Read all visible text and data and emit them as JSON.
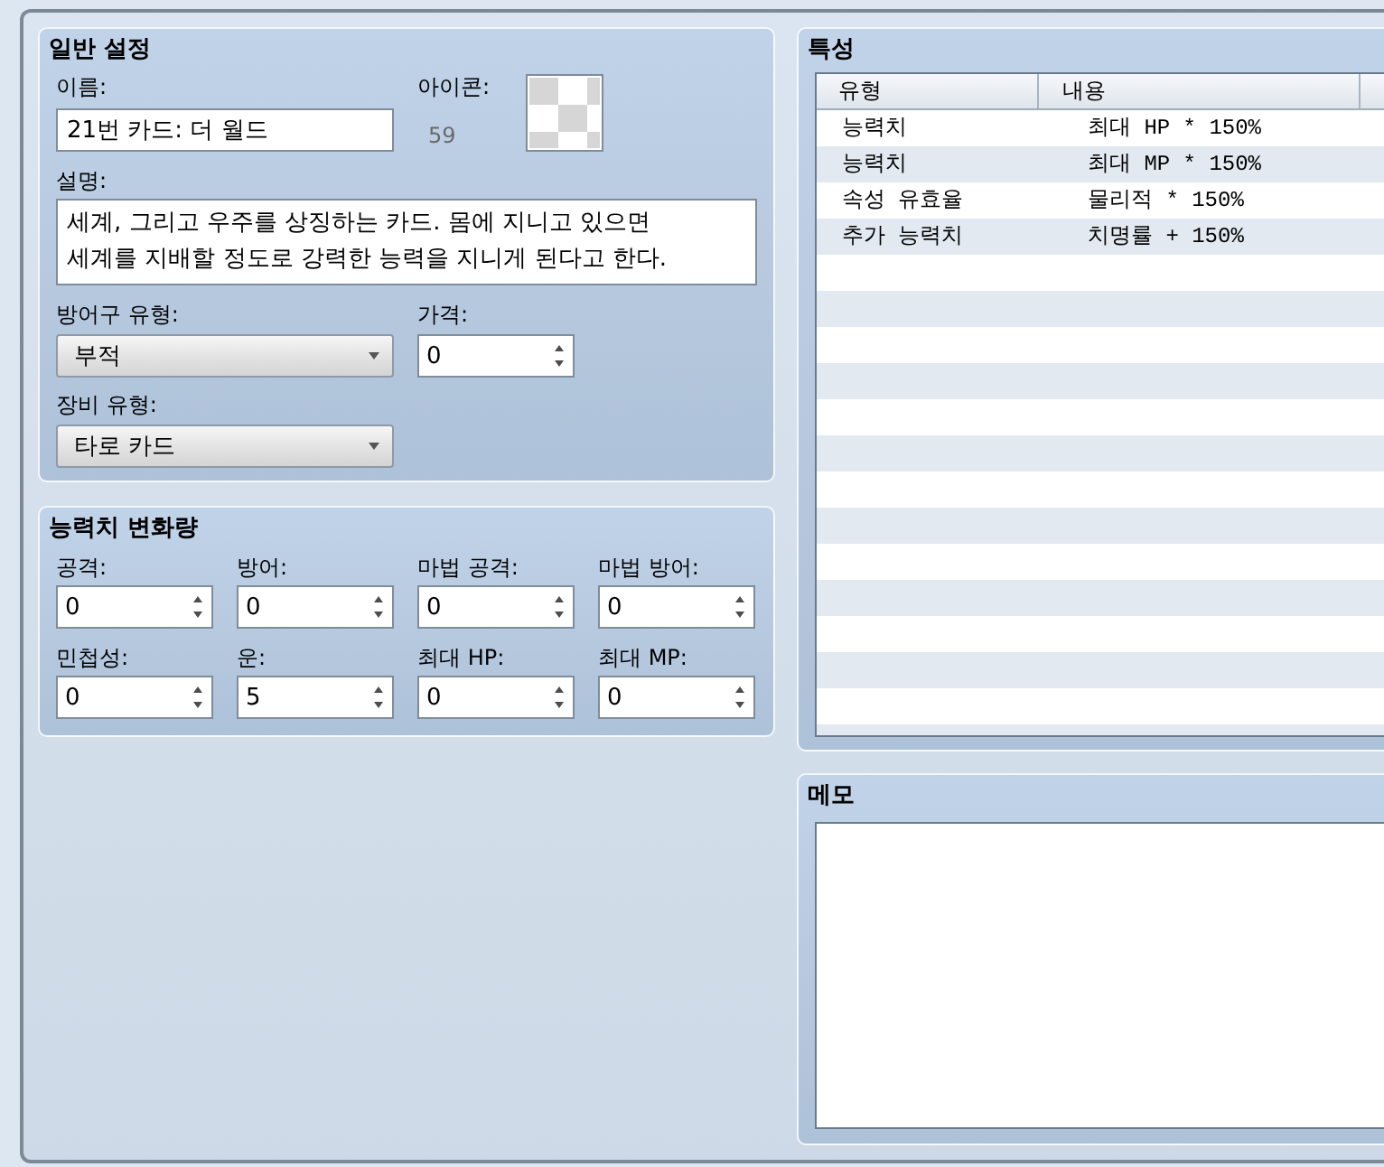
{
  "general": {
    "title": "일반 설정",
    "name": {
      "label": "이름:",
      "value": "21번 카드: 더 월드"
    },
    "icon": {
      "label": "아이콘:",
      "index": "59"
    },
    "description": {
      "label": "설명:",
      "value": "세계, 그리고 우주를 상징하는 카드. 몸에 지니고 있으면\n세계를 지배할 정도로 강력한 능력을 지니게 된다고 한다."
    },
    "armor_type": {
      "label": "방어구 유형:",
      "value": "부적"
    },
    "price": {
      "label": "가격:",
      "value": "0"
    },
    "equipment_type": {
      "label": "장비 유형:",
      "value": "타로 카드"
    }
  },
  "parameter_changes": {
    "title": "능력치 변화량",
    "fields": [
      {
        "label": "공격:",
        "value": "0"
      },
      {
        "label": "방어:",
        "value": "0"
      },
      {
        "label": "마법 공격:",
        "value": "0"
      },
      {
        "label": "마법 방어:",
        "value": "0"
      },
      {
        "label": "민첩성:",
        "value": "0"
      },
      {
        "label": "운:",
        "value": "5"
      },
      {
        "label": "최대 HP:",
        "value": "0"
      },
      {
        "label": "최대 MP:",
        "value": "0"
      }
    ]
  },
  "traits": {
    "title": "특성",
    "columns": [
      "유형",
      "내용"
    ],
    "rows": [
      {
        "cells": [
          "능력치",
          "최대 HP * 150%"
        ],
        "selected": false
      },
      {
        "cells": [
          "능력치",
          "최대 MP * 150%"
        ],
        "selected": false
      },
      {
        "cells": [
          "속성 유효율",
          "물리적 * 150%"
        ],
        "selected": false
      },
      {
        "cells": [
          "추가 능력치",
          "치명률 + 150%"
        ],
        "selected": false
      }
    ]
  },
  "memo": {
    "title": "메모"
  }
}
